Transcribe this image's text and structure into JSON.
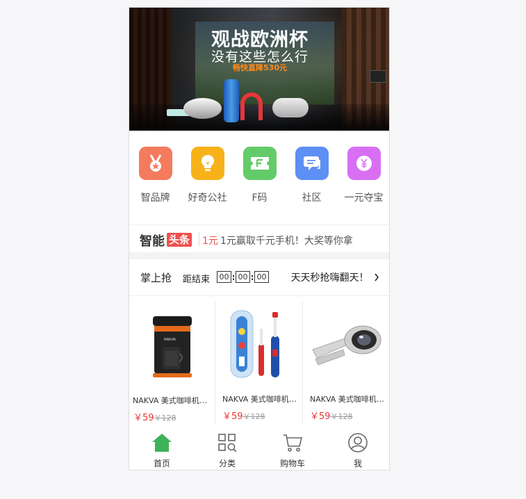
{
  "banner": {
    "title": "观战欧洲杯",
    "subtitle": "没有这些怎么行",
    "promo": "畅快直降530元"
  },
  "categories": [
    {
      "label": "智品牌",
      "icon": "medal-icon",
      "color": "#f47b5d"
    },
    {
      "label": "好奇公社",
      "icon": "lightbulb-icon",
      "color": "#f7b21a"
    },
    {
      "label": "F码",
      "icon": "f-code-ticket-icon",
      "color": "#64cb6a"
    },
    {
      "label": "社区",
      "icon": "chat-bubbles-icon",
      "color": "#5d8ff4"
    },
    {
      "label": "一元夺宝",
      "icon": "yuan-coin-icon",
      "color": "#d86ff3"
    }
  ],
  "headline": {
    "brand": "智能",
    "tag": "头条",
    "price": "1元",
    "text": "1元赢取千元手机！大奖等你拿"
  },
  "flash_sale": {
    "title": "掌上抢",
    "countdown_label": "距结束",
    "hours": "00",
    "minutes": "00",
    "seconds": "00",
    "promo": "天天秒抢嗨翻天！"
  },
  "products": [
    {
      "name": "NAKVA 美式咖啡机一体机",
      "price": "￥59",
      "old_price": "￥128",
      "icon": "coffee-machine-icon"
    },
    {
      "name": "NAKVA 美式咖啡机一体机",
      "price": "￥59",
      "old_price": "￥128",
      "icon": "electric-toothbrush-icon"
    },
    {
      "name": "NAKVA 美式咖啡机一体机",
      "price": "￥59",
      "old_price": "￥128",
      "icon": "clip-lens-icon"
    }
  ],
  "tabbar": [
    {
      "label": "首页",
      "icon": "home-icon",
      "active": true
    },
    {
      "label": "分类",
      "icon": "category-grid-icon",
      "active": false
    },
    {
      "label": "购物车",
      "icon": "cart-icon",
      "active": false
    },
    {
      "label": "我",
      "icon": "user-icon",
      "active": false
    }
  ],
  "colors": {
    "accent_red": "#ef4f4f",
    "tab_active": "#3eb15b"
  }
}
